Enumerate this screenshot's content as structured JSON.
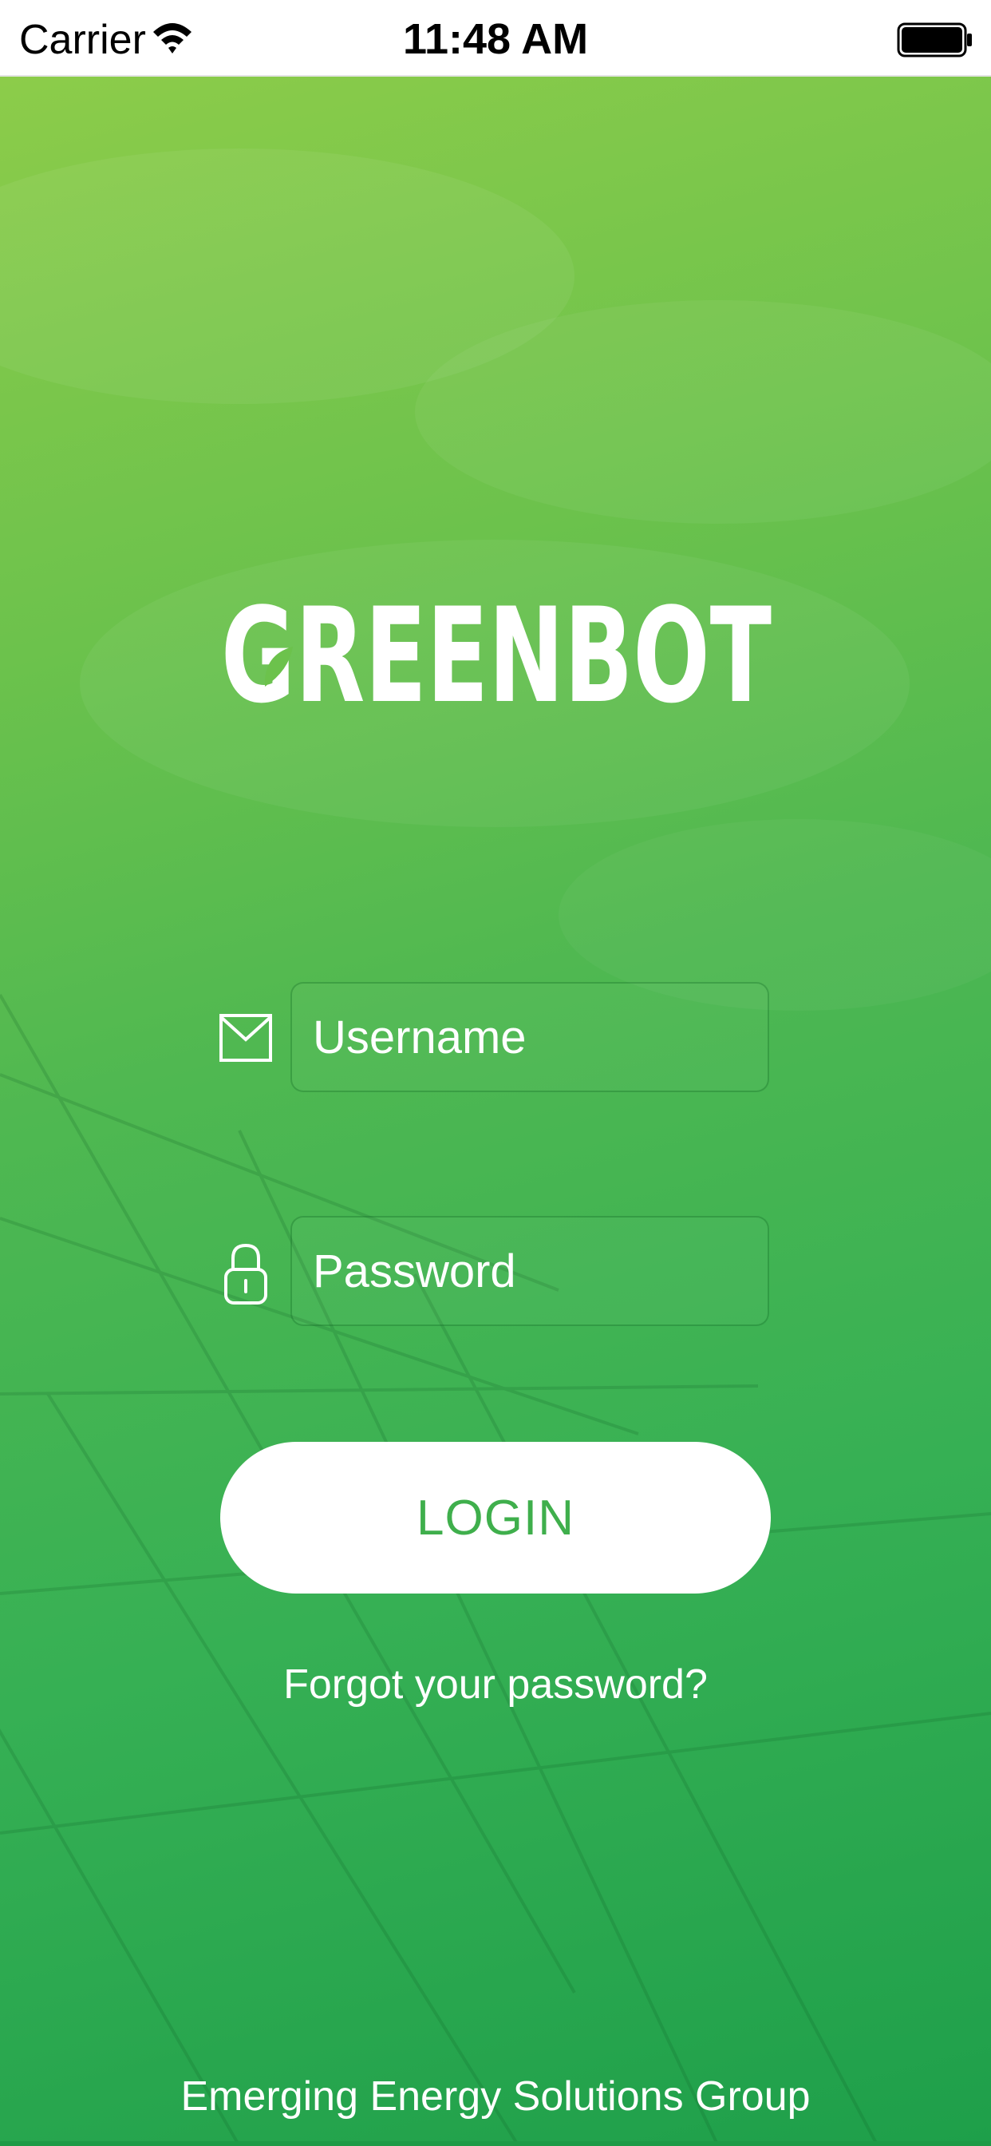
{
  "status_bar": {
    "carrier": "Carrier",
    "time": "11:48 AM",
    "wifi_icon": "wifi-icon",
    "battery_icon": "battery-icon"
  },
  "app": {
    "logo_text": "GREENBOT",
    "brand_color": "#4cb84f",
    "accent_text_color": "#3faf4c"
  },
  "login_form": {
    "username": {
      "icon": "mail-icon",
      "placeholder": "Username",
      "value": ""
    },
    "password": {
      "icon": "lock-icon",
      "placeholder": "Password",
      "value": ""
    },
    "login_label": "LOGIN",
    "forgot_label": "Forgot your password?"
  },
  "footer": {
    "text": "Emerging Energy Solutions Group"
  }
}
